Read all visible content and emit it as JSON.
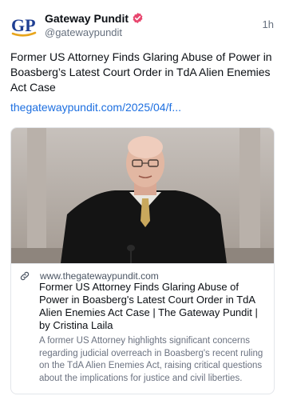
{
  "post": {
    "author_name": "Gateway Pundit",
    "author_handle": "@gatewaypundit",
    "timestamp": "1h",
    "avatar_text": "GP",
    "text": "Former US Attorney Finds Glaring Abuse of Power in Boasberg’s Latest Court Order in TdA Alien Enemies Act Case",
    "link_text": "thegatewaypundit.com/2025/04/f..."
  },
  "card": {
    "domain": "www.thegatewaypundit.com",
    "title": "Former US Attorney Finds Glaring Abuse of Power in Boasberg's Latest Court Order in TdA Alien Enemies Act Case | The Gateway Pundit | by Cristina Laila",
    "description": "A former US Attorney highlights significant concerns regarding judicial overreach in Boasberg's recent ruling on the TdA Alien Enemies Act, raising critical questions about the implications for justice and civil liberties.",
    "image_icon": "courtroom-speaker-photo"
  },
  "colors": {
    "link": "#1d6fe0",
    "avatar_blue": "#1f3f93",
    "avatar_gold": "#e8a51c",
    "verified_badge": "#e8476f",
    "secondary_text": "#66707e"
  },
  "icons": {
    "verified": "verified-badge-icon",
    "link": "link-chain-icon"
  }
}
